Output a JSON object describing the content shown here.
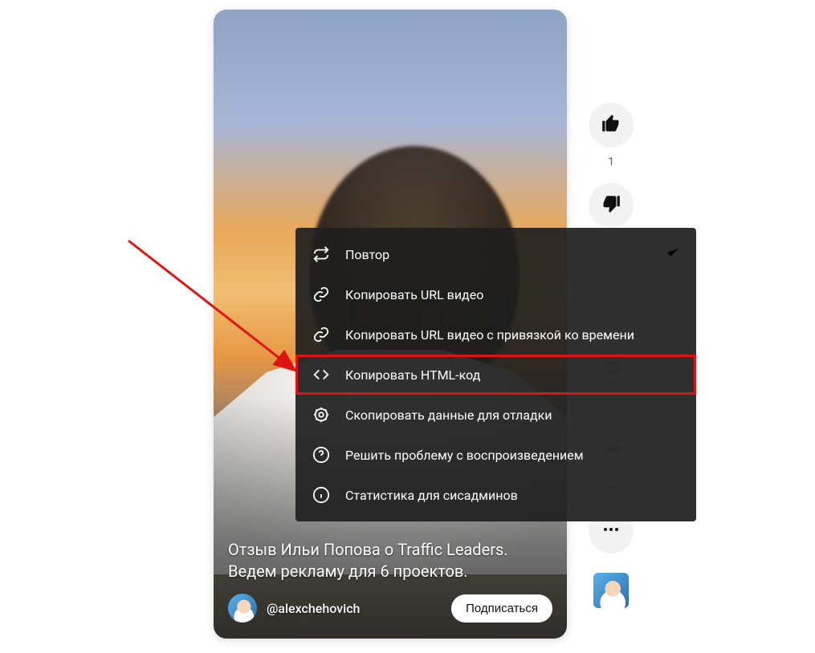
{
  "video": {
    "title": "Отзыв Ильи Попова о Traffic Leaders. Ведем рекламу для 6 проектов.",
    "channel_handle": "@alexchehovich",
    "subscribe_label": "Подписаться"
  },
  "rail": {
    "like_count": "1",
    "dislike_label": "Не …",
    "comments_count": "0",
    "share_label": "Подели…"
  },
  "context_menu": {
    "items": [
      {
        "id": "loop",
        "label": "Повтор",
        "icon": "repeat",
        "checked": true
      },
      {
        "id": "copy_url",
        "label": "Копировать URL видео",
        "icon": "link"
      },
      {
        "id": "copy_url_t",
        "label": "Копировать URL видео с привязкой ко времени",
        "icon": "link"
      },
      {
        "id": "copy_html",
        "label": "Копировать HTML-код",
        "icon": "code",
        "highlight": true
      },
      {
        "id": "copy_debug",
        "label": "Скопировать данные для отладки",
        "icon": "bug"
      },
      {
        "id": "troubleshoot",
        "label": "Решить проблему с воспроизведением",
        "icon": "help"
      },
      {
        "id": "stats",
        "label": "Статистика для сисадминов",
        "icon": "info"
      }
    ]
  }
}
